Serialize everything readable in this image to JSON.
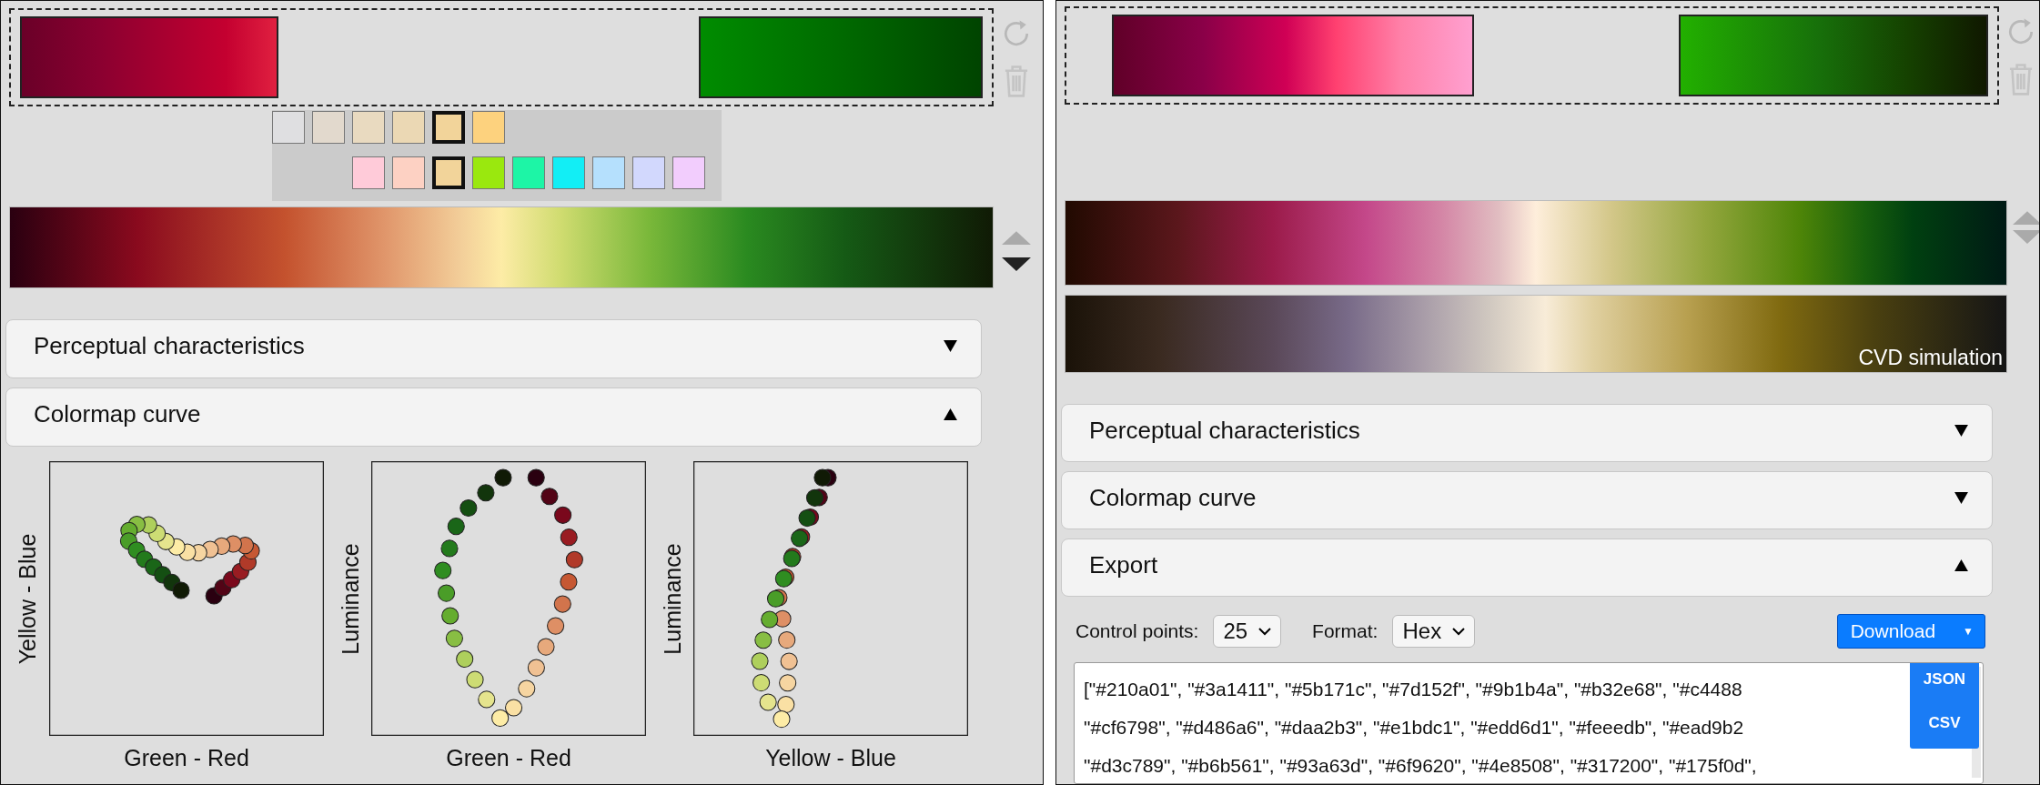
{
  "panels": [
    {
      "reorder": {
        "up_active": false,
        "down_active": true
      },
      "swatch_rows": [
        [
          {
            "color": "#dfdfe1",
            "selected": false
          },
          {
            "color": "#e2d9cd",
            "selected": false
          },
          {
            "color": "#e9dac0",
            "selected": false
          },
          {
            "color": "#ebd8b4",
            "selected": false
          },
          {
            "color": "#f2d49a",
            "selected": true
          },
          {
            "color": "#fdd27e",
            "selected": false
          }
        ],
        [
          {
            "color": "#ffcbd9",
            "selected": false
          },
          {
            "color": "#fdd1c3",
            "selected": false
          },
          {
            "color": "#f2d49a",
            "selected": true
          },
          {
            "color": "#9ae80e",
            "selected": false
          },
          {
            "color": "#1df5a6",
            "selected": false
          },
          {
            "color": "#12eef5",
            "selected": false
          },
          {
            "color": "#b5e0fd",
            "selected": false
          },
          {
            "color": "#d2d8fd",
            "selected": false
          },
          {
            "color": "#f2cdfd",
            "selected": false
          }
        ]
      ],
      "sections": [
        {
          "title": "Perceptual characteristics",
          "expanded": false
        },
        {
          "title": "Colormap curve",
          "expanded": true
        }
      ],
      "curve_plots": [
        {
          "xlabel": "Green - Red",
          "ylabel": "Yellow - Blue"
        },
        {
          "xlabel": "Green - Red",
          "ylabel": "Luminance"
        },
        {
          "xlabel": "Yellow - Blue",
          "ylabel": "Luminance"
        }
      ]
    },
    {
      "reorder": {
        "up_active": false,
        "down_active": false
      },
      "cvd_label": "CVD simulation",
      "sections": [
        {
          "title": "Perceptual characteristics",
          "expanded": false
        },
        {
          "title": "Colormap curve",
          "expanded": false
        },
        {
          "title": "Export",
          "expanded": true
        }
      ],
      "export": {
        "control_points_label": "Control points:",
        "control_points": "25",
        "format_label": "Format:",
        "format": "Hex",
        "download_label": "Download",
        "download_caret": "▼",
        "download_menu": [
          "JSON",
          "CSV"
        ],
        "output_lines": [
          "[\"#210a01\", \"#3a1411\", \"#5b171c\", \"#7d152f\", \"#9b1b4a\", \"#b32e68\", \"#c4488",
          "\"#cf6798\", \"#d486a6\", \"#daa2b3\", \"#e1bdc1\", \"#edd6d1\", \"#feeedb\", \"#ead9b2",
          "\"#d3c789\", \"#b6b561\", \"#93a63d\", \"#6f9620\", \"#4e8508\", \"#317200\", \"#175f0d\","
        ]
      }
    }
  ]
}
